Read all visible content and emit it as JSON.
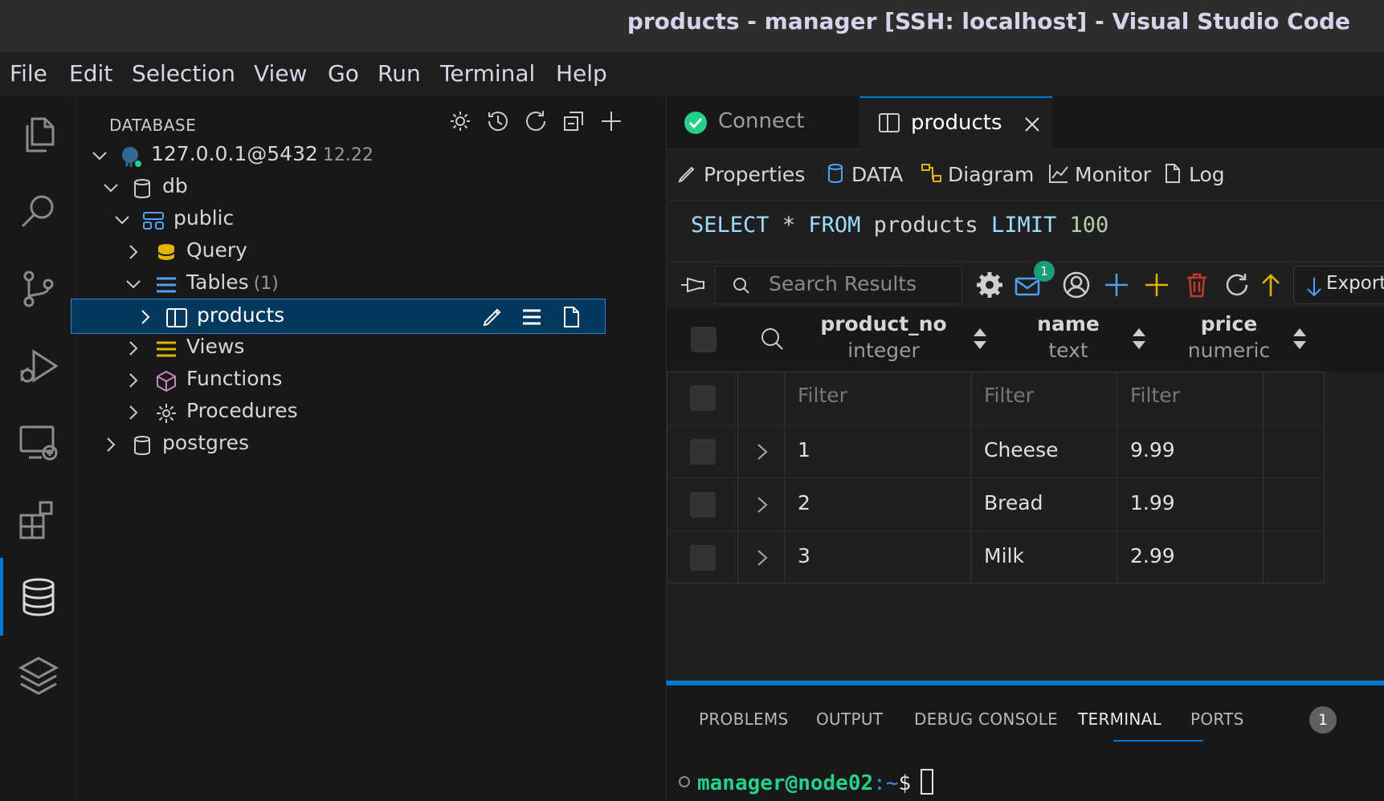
{
  "window": {
    "title": "products - manager [SSH: localhost] - Visual Studio Code"
  },
  "menu": [
    "File",
    "Edit",
    "Selection",
    "View",
    "Go",
    "Run",
    "Terminal",
    "Help"
  ],
  "activity_bar": [
    "explorer-icon",
    "search-icon",
    "source-control-icon",
    "run-debug-icon",
    "remote-explorer-icon",
    "extensions-icon",
    "database-icon",
    "layers-icon"
  ],
  "sidebar": {
    "header": "DATABASE",
    "header_actions": [
      "gear-icon",
      "history-icon",
      "refresh-icon",
      "collapse-all-icon",
      "add-icon"
    ],
    "tree": {
      "connection": {
        "label": "127.0.0.1@5432",
        "version": "12.22"
      },
      "db": "db",
      "schema": "public",
      "query": "Query",
      "tables": {
        "label": "Tables",
        "count": "(1)"
      },
      "table_item": "products",
      "views": "Views",
      "functions": "Functions",
      "procedures": "Procedures",
      "postgres": "postgres"
    }
  },
  "editor": {
    "tabs": [
      {
        "label": "Connect",
        "icon": "check-circle-icon"
      },
      {
        "label": "products",
        "icon": "table-icon",
        "active": true
      }
    ],
    "subnav": [
      {
        "label": "Properties",
        "icon": "pencil-icon"
      },
      {
        "label": "DATA",
        "icon": "database-icon",
        "active": true
      },
      {
        "label": "Diagram",
        "icon": "diagram-icon"
      },
      {
        "label": "Monitor",
        "icon": "chart-icon"
      },
      {
        "label": "Log",
        "icon": "file-icon"
      }
    ],
    "sql": {
      "kw1": "SELECT",
      "star": "*",
      "kw2": "FROM",
      "table": "products",
      "kw3": "LIMIT",
      "limit": "100"
    },
    "toolbar": {
      "search_placeholder": "Search Results",
      "notification_count": "1",
      "export_label": "Export"
    },
    "grid": {
      "columns": [
        {
          "name": "product_no",
          "type": "integer"
        },
        {
          "name": "name",
          "type": "text"
        },
        {
          "name": "price",
          "type": "numeric"
        }
      ],
      "filter_placeholder": "Filter",
      "rows": [
        {
          "product_no": "1",
          "name": "Cheese",
          "price": "9.99"
        },
        {
          "product_no": "2",
          "name": "Bread",
          "price": "1.99"
        },
        {
          "product_no": "3",
          "name": "Milk",
          "price": "2.99"
        }
      ]
    }
  },
  "panel": {
    "tabs": [
      "PROBLEMS",
      "OUTPUT",
      "DEBUG CONSOLE",
      "TERMINAL",
      "PORTS"
    ],
    "active_tab": "TERMINAL",
    "ports_badge": "1",
    "terminal": {
      "user_host": "manager@node02",
      "path": ":~",
      "prompt": "$"
    }
  },
  "colors": {
    "accent": "#0078d4",
    "keyword": "#9cdcfe",
    "number": "#b5cea8",
    "user_host": "#23d18b",
    "path": "#3b8eea",
    "table_icon": "#4ea1f5",
    "yellow": "#e0b400",
    "purple": "#c586c0"
  }
}
